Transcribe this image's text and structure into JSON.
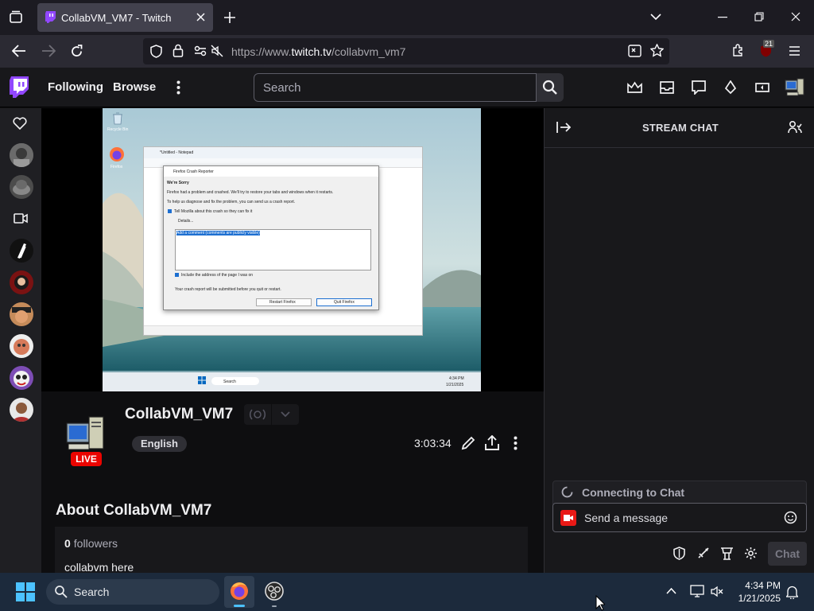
{
  "browser": {
    "tab_title": "CollabVM_VM7 - Twitch",
    "url_prefix": "https://www.",
    "url_host": "twitch.tv",
    "url_path": "/collabvm_vm7",
    "extension_badge": "21"
  },
  "twitch_nav": {
    "following": "Following",
    "browse": "Browse",
    "search_placeholder": "Search"
  },
  "channel": {
    "name": "CollabVM_VM7",
    "language": "English",
    "uptime": "3:03:34",
    "live_badge": "LIVE",
    "about_title": "About CollabVM_VM7",
    "followers_count": "0",
    "followers_label": "followers",
    "description": "collabvm here"
  },
  "chat": {
    "title": "STREAM CHAT",
    "connecting": "Connecting to Chat",
    "placeholder": "Send a message",
    "send_label": "Chat"
  },
  "stream_desktop": {
    "notepad_title": "*Untitled - Notepad",
    "dialog_title": "Firefox Crash Reporter",
    "dialog_heading": "We're Sorry",
    "dialog_body": "Firefox had a problem and crashed. We'll try to restore your tabs and windows when it restarts.",
    "dialog_help": "To help us diagnose and fix the problem, you can send us a crash report.",
    "dialog_check1": "Tell Mozilla about this crash so they can fix it",
    "dialog_details": "Details...",
    "dialog_comment": "Add a comment (comments are publicly visible)",
    "dialog_check2": "Include the address of the page I was on",
    "dialog_footer": "Your crash report will be submitted before you quit or restart.",
    "btn_restart": "Restart Firefox",
    "btn_quit": "Quit Firefox",
    "recycle_label": "Recycle Bin",
    "firefox_label": "Firefox",
    "taskbar_search": "Search",
    "clock_time": "4:34 PM",
    "clock_date": "1/21/2025"
  },
  "os_taskbar": {
    "search": "Search",
    "time": "4:34 PM",
    "date": "1/21/2025"
  },
  "colors": {
    "twitch_purple": "#9147ff",
    "live_red": "#eb0400",
    "bg_dark": "#0e0e10"
  }
}
